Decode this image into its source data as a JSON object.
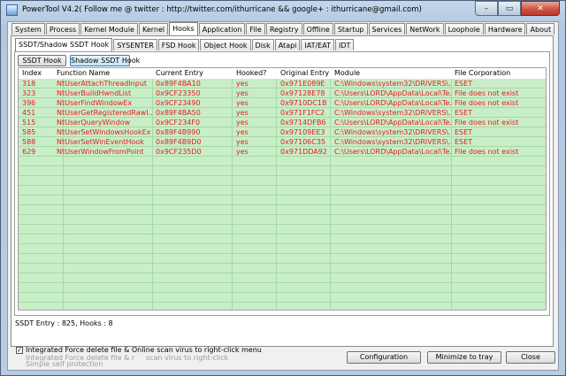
{
  "window": {
    "title": "PowerTool V4.2( Follow me @ twitter : http://twitter.com/ithurricane && google+ : ithurricane@gmail.com)",
    "caption_min": "–",
    "caption_max": "▭",
    "caption_close": "✕"
  },
  "main_tabs": [
    "System",
    "Process",
    "Kernel Module",
    "Kernel",
    "Hooks",
    "Application",
    "File",
    "Registry",
    "Offline",
    "Startup",
    "Services",
    "NetWork",
    "Loophole",
    "Hardware",
    "About"
  ],
  "main_active_tab": "Hooks",
  "sub_tabs": [
    "SSDT/Shadow SSDT Hook",
    "SYSENTER",
    "FSD Hook",
    "Object Hook",
    "Disk",
    "Atapi",
    "IAT/EAT",
    "IDT"
  ],
  "sub_active_tab": "SSDT/Shadow SSDT Hook",
  "sub_buttons": {
    "ssdt": "SSDT Hook",
    "shadow": "Shadow SSDT Hook"
  },
  "table": {
    "columns": [
      "Index",
      "Function Name",
      "Current Entry",
      "Hooked?",
      "Original Entry",
      "Module",
      "File Corporation"
    ],
    "rows": [
      [
        "318",
        "NtUserAttachThreadInput",
        "0x89F4BA10",
        "yes",
        "0x971E089E",
        "C:\\Windows\\system32\\DRIVERS\\...",
        "ESET"
      ],
      [
        "323",
        "NtUserBuildHwndList",
        "0x9CF23350",
        "yes",
        "0x97128E78",
        "C:\\Users\\LORD\\AppData\\Local\\Te...",
        "File does not exist"
      ],
      [
        "396",
        "NtUserFindWindowEx",
        "0x9CF23490",
        "yes",
        "0x9710DC1B",
        "C:\\Users\\LORD\\AppData\\Local\\Te...",
        "File does not exist"
      ],
      [
        "451",
        "NtUserGetRegisteredRawI...",
        "0x89F4BA50",
        "yes",
        "0x971F1FC2",
        "C:\\Windows\\system32\\DRIVERS\\...",
        "ESET"
      ],
      [
        "515",
        "NtUserQueryWindow",
        "0x9CF234F0",
        "yes",
        "0x9714DFB6",
        "C:\\Users\\LORD\\AppData\\Local\\Te...",
        "File does not exist"
      ],
      [
        "585",
        "NtUserSetWindowsHookEx",
        "0x89F4B990",
        "yes",
        "0x97109EE3",
        "C:\\Windows\\system32\\DRIVERS\\...",
        "ESET"
      ],
      [
        "588",
        "NtUserSetWinEventHook",
        "0x89F4B9D0",
        "yes",
        "0x97106C35",
        "C:\\Windows\\system32\\DRIVERS\\...",
        "ESET"
      ],
      [
        "629",
        "NtUserWindowFromPoint",
        "0x9CF235D0",
        "yes",
        "0x971DDA92",
        "C:\\Users\\LORD\\AppData\\Local\\Te...",
        "File does not exist"
      ]
    ]
  },
  "status": "SSDT Entry : 825, Hooks : 8",
  "bottom": {
    "checkbox_label": "Integrated Force delete file & Online scan virus to right-click menu",
    "checkbox_checked": "✓",
    "ghost_line1": "Integrated Force delete file & r",
    "ghost_line1b": "scan virus to right-click",
    "ghost_line2": "Simple self protection",
    "configuration": "Configuration",
    "minimize": "Minimize to tray",
    "close": "Close"
  },
  "colors": {
    "row_bg": "#c8eec8",
    "hooked_text": "#e02020"
  }
}
